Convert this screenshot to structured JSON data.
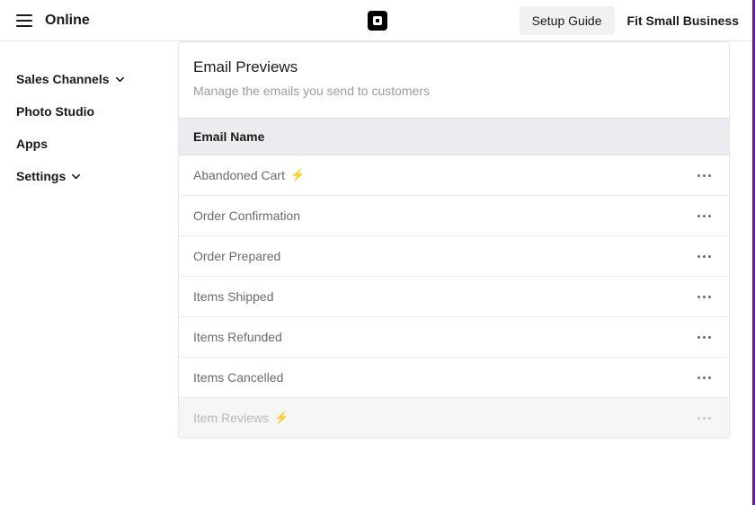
{
  "header": {
    "section_label": "Online",
    "setup_button": "Setup Guide",
    "business_name": "Fit Small Business"
  },
  "sidebar": {
    "items": [
      {
        "label": "Sales Channels",
        "has_chevron": true
      },
      {
        "label": "Photo Studio",
        "has_chevron": false
      },
      {
        "label": "Apps",
        "has_chevron": false
      },
      {
        "label": "Settings",
        "has_chevron": true
      }
    ]
  },
  "card": {
    "title": "Email Previews",
    "subtitle": "Manage the emails you send to customers",
    "column_header": "Email Name",
    "rows": [
      {
        "name": "Abandoned Cart",
        "bolt": true,
        "disabled": false
      },
      {
        "name": "Order Confirmation",
        "bolt": false,
        "disabled": false
      },
      {
        "name": "Order Prepared",
        "bolt": false,
        "disabled": false
      },
      {
        "name": "Items Shipped",
        "bolt": false,
        "disabled": false
      },
      {
        "name": "Items Refunded",
        "bolt": false,
        "disabled": false
      },
      {
        "name": "Items Cancelled",
        "bolt": false,
        "disabled": false
      },
      {
        "name": "Item Reviews",
        "bolt": true,
        "disabled": true
      }
    ]
  }
}
